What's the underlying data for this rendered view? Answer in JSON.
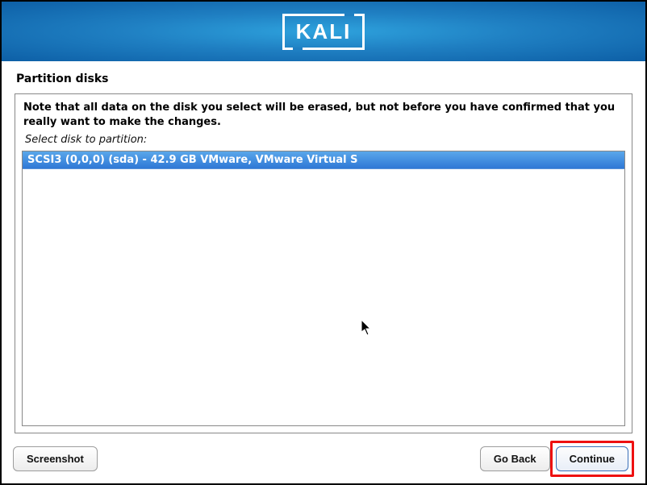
{
  "logo": {
    "text": "KALI"
  },
  "page": {
    "title": "Partition disks"
  },
  "panel": {
    "warning": "Note that all data on the disk you select will be erased, but not before you have confirmed that you really want to make the changes.",
    "prompt": "Select disk to partition:",
    "disks": [
      {
        "label": "SCSI3 (0,0,0) (sda) - 42.9 GB VMware, VMware Virtual S",
        "selected": true
      }
    ]
  },
  "buttons": {
    "screenshot": "Screenshot",
    "go_back": "Go Back",
    "continue": "Continue"
  }
}
